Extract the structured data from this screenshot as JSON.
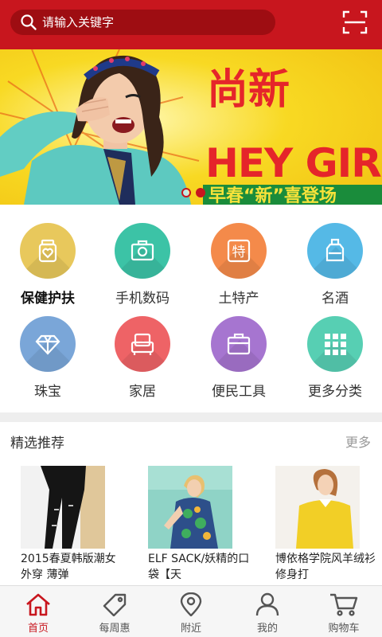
{
  "header": {
    "search_placeholder": "请输入关键字",
    "search_icon": "search-icon",
    "scan_icon": "scan-icon"
  },
  "banner": {
    "headline_cn": "尚新",
    "headline_en": "HEY GIRL",
    "subline": "早春“新”喜登场",
    "slides": 2,
    "active_slide": 1
  },
  "categories": [
    {
      "label": "保健护扶",
      "icon": "health-jar-icon",
      "color": "#e8c85c"
    },
    {
      "label": "手机数码",
      "icon": "camera-icon",
      "color": "#3cc3a6"
    },
    {
      "label": "土特产",
      "icon": "specialty-icon",
      "color": "#f48a4a"
    },
    {
      "label": "名酒",
      "icon": "liquor-bottle-icon",
      "color": "#55b9e6"
    },
    {
      "label": "珠宝",
      "icon": "diamond-icon",
      "color": "#7aa6d8"
    },
    {
      "label": "家居",
      "icon": "sofa-icon",
      "color": "#ee6366"
    },
    {
      "label": "便民工具",
      "icon": "toolbox-icon",
      "color": "#a675d0"
    },
    {
      "label": "更多分类",
      "icon": "grid-icon",
      "color": "#57cfb3"
    }
  ],
  "featured": {
    "title": "精选推荐",
    "more": "更多",
    "products": [
      {
        "name": "2015春夏韩版潮女外穿 薄弹"
      },
      {
        "name": "ELF SACK/妖精的口袋【天"
      },
      {
        "name": "博依格学院风羊绒衫修身打"
      }
    ]
  },
  "tabs": [
    {
      "label": "首页",
      "icon": "home-icon",
      "active": true
    },
    {
      "label": "每周惠",
      "icon": "price-tag-icon",
      "active": false
    },
    {
      "label": "附近",
      "icon": "location-pin-icon",
      "active": false
    },
    {
      "label": "我的",
      "icon": "user-icon",
      "active": false
    },
    {
      "label": "购物车",
      "icon": "cart-icon",
      "active": false
    }
  ],
  "colors": {
    "brand_red": "#c8161e",
    "search_bg": "#9e0d12",
    "banner_yellow": "#f5d21c"
  }
}
